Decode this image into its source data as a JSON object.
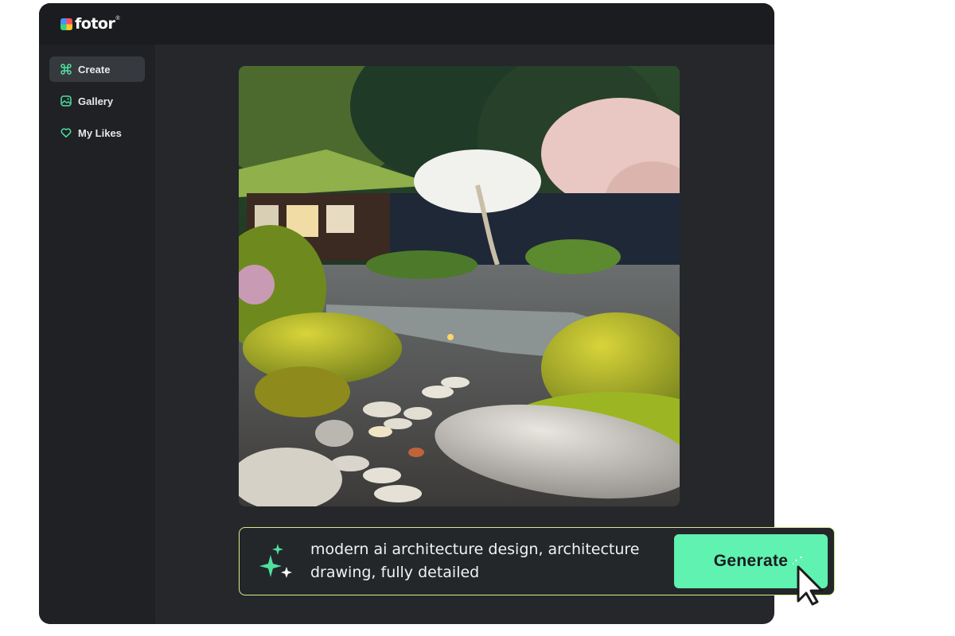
{
  "app": {
    "brand": "fotor",
    "brand_mark": "®"
  },
  "sidebar": {
    "items": [
      {
        "label": "Create",
        "icon": "command-icon",
        "active": true
      },
      {
        "label": "Gallery",
        "icon": "image-icon",
        "active": false
      },
      {
        "label": "My Likes",
        "icon": "heart-icon",
        "active": false
      }
    ]
  },
  "canvas": {
    "image": "zen-garden-generated-image"
  },
  "prompt": {
    "text": "modern ai architecture design, architecture drawing, fully detailed",
    "generate_label": "Generate"
  },
  "colors": {
    "accent": "#5ff2b0",
    "icon_green": "#4fe0a0",
    "prompt_border": "#d6ee8a",
    "app_bg": "#25272b",
    "sidebar_bg": "#1f2124",
    "topbar_bg": "#1b1c1f"
  }
}
